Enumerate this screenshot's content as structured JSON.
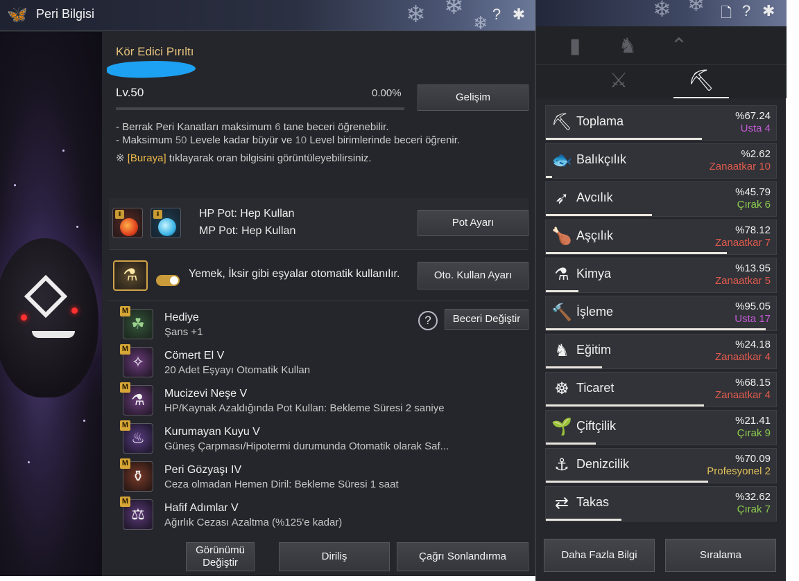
{
  "left_window": {
    "title": "Peri Bilgisi",
    "icons": {
      "logo": "butterfly-icon",
      "help": "?",
      "close": "snowflake-close-icon"
    },
    "fairy": {
      "name": "Kör Edici Pırıltı",
      "level_label": "Lv.",
      "level": "50",
      "progress_text": "0.00%",
      "progress": 0.0,
      "growth_button": "Gelişim"
    },
    "description": {
      "line1_pre": "- Berrak Peri Kanatları maksimum ",
      "line1_num": "6",
      "line1_post": " tane beceri öğrenebilir.",
      "line2_pre": "- Maksimum ",
      "line2_num1": "50",
      "line2_mid": " Levele kadar büyür ve ",
      "line2_num2": "10",
      "line2_post": " Level birimlerinde beceri öğrenir.",
      "note_mark": "※ ",
      "note_link": "[Buraya]",
      "note_post": " tıklayarak oran bilgisini görüntüleyebilirsiniz."
    },
    "pots": {
      "hp_label": "HP Pot: Hep Kullan",
      "mp_label": "MP Pot: Hep Kullan",
      "button": "Pot Ayarı"
    },
    "auto_use": {
      "text": "Yemek, İksir gibi eşyalar otomatik kullanılır.",
      "toggle_on": true,
      "button": "Oto. Kullan Ayarı"
    },
    "skills": {
      "change_button": "Beceri Değiştir",
      "help": "?",
      "badge": "M",
      "items": [
        {
          "name": "Hediye",
          "desc": "Şans +1",
          "icon": "clover-icon"
        },
        {
          "name": "Cömert El V",
          "desc": "20 Adet Eşyayı Otomatik Kullan",
          "icon": "fairy-icon"
        },
        {
          "name": "Mucizevi Neşe V",
          "desc": "HP/Kaynak Azaldığında Pot Kullan: Bekleme Süresi 2 saniye",
          "icon": "potion-icon"
        },
        {
          "name": "Kurumayan Kuyu V",
          "desc": "Güneş Çarpması/Hipotermi durumunda Otomatik olarak Saf...",
          "icon": "bowl-icon"
        },
        {
          "name": "Peri Gözyaşı IV",
          "desc": "Ceza olmadan Hemen Diril: Bekleme Süresi 1 saat",
          "icon": "tear-vase-icon"
        },
        {
          "name": "Hafif Adımlar V",
          "desc": "Ağırlık Cezası Azaltma (%125'e kadar)",
          "icon": "weight-icon"
        }
      ]
    },
    "footer": {
      "appearance_line1": "Görünümü",
      "appearance_line2": "Değiştir",
      "revive": "Diriliş",
      "end_summon": "Çağrı Sonlandırma"
    }
  },
  "right_window": {
    "icons": {
      "page": "document-icon",
      "help": "?",
      "close": "snowflake-close-icon"
    },
    "top_tabs": [
      "bar-chart-icon",
      "horse-head-icon",
      "double-chevron-up-icon"
    ],
    "sub_tabs": [
      "crossed-swords-icon",
      "pickaxe-icon"
    ],
    "active_sub_tab": 1,
    "skills": [
      {
        "name": "Toplama",
        "percent": "%67.24",
        "rank": "Usta",
        "level": "4",
        "rank_class": "rank-master",
        "progress": 0.6724,
        "icon": "pickaxe-icon",
        "glyph": "⛏"
      },
      {
        "name": "Balıkçılık",
        "percent": "%2.62",
        "rank": "Zanaatkar",
        "level": "10",
        "rank_class": "rank-artisan",
        "progress": 0.0262,
        "icon": "fish-icon",
        "glyph": "🐟"
      },
      {
        "name": "Avcılık",
        "percent": "%45.79",
        "rank": "Çırak",
        "level": "6",
        "rank_class": "rank-apprentice",
        "progress": 0.4579,
        "icon": "rifle-icon",
        "glyph": "➶"
      },
      {
        "name": "Aşçılık",
        "percent": "%78.12",
        "rank": "Zanaatkar",
        "level": "7",
        "rank_class": "rank-artisan",
        "progress": 0.7812,
        "icon": "roast-icon",
        "glyph": "🍗"
      },
      {
        "name": "Kimya",
        "percent": "%13.95",
        "rank": "Zanaatkar",
        "level": "5",
        "rank_class": "rank-artisan",
        "progress": 0.1395,
        "icon": "flask-icon",
        "glyph": "⚗"
      },
      {
        "name": "İşleme",
        "percent": "%95.05",
        "rank": "Usta",
        "level": "17",
        "rank_class": "rank-master",
        "progress": 0.9505,
        "icon": "hammer-icon",
        "glyph": "🔨"
      },
      {
        "name": "Eğitim",
        "percent": "%24.18",
        "rank": "Zanaatkar",
        "level": "4",
        "rank_class": "rank-artisan",
        "progress": 0.2418,
        "icon": "horse-icon",
        "glyph": "♞"
      },
      {
        "name": "Ticaret",
        "percent": "%68.15",
        "rank": "Zanaatkar",
        "level": "4",
        "rank_class": "rank-artisan",
        "progress": 0.6815,
        "icon": "wheel-icon",
        "glyph": "☸"
      },
      {
        "name": "Çiftçilik",
        "percent": "%21.41",
        "rank": "Çırak",
        "level": "9",
        "rank_class": "rank-apprentice",
        "progress": 0.2141,
        "icon": "sprout-icon",
        "glyph": "🌱"
      },
      {
        "name": "Denizcilik",
        "percent": "%70.09",
        "rank": "Profesyonel",
        "level": "2",
        "rank_class": "rank-professional",
        "progress": 0.7009,
        "icon": "anchor-icon",
        "glyph": "⚓"
      },
      {
        "name": "Takas",
        "percent": "%32.62",
        "rank": "Çırak",
        "level": "7",
        "rank_class": "rank-apprentice",
        "progress": 0.3262,
        "icon": "exchange-icon",
        "glyph": "⇄"
      }
    ],
    "footer": {
      "more_info": "Daha Fazla Bilgi",
      "ranking": "Sıralama"
    }
  }
}
